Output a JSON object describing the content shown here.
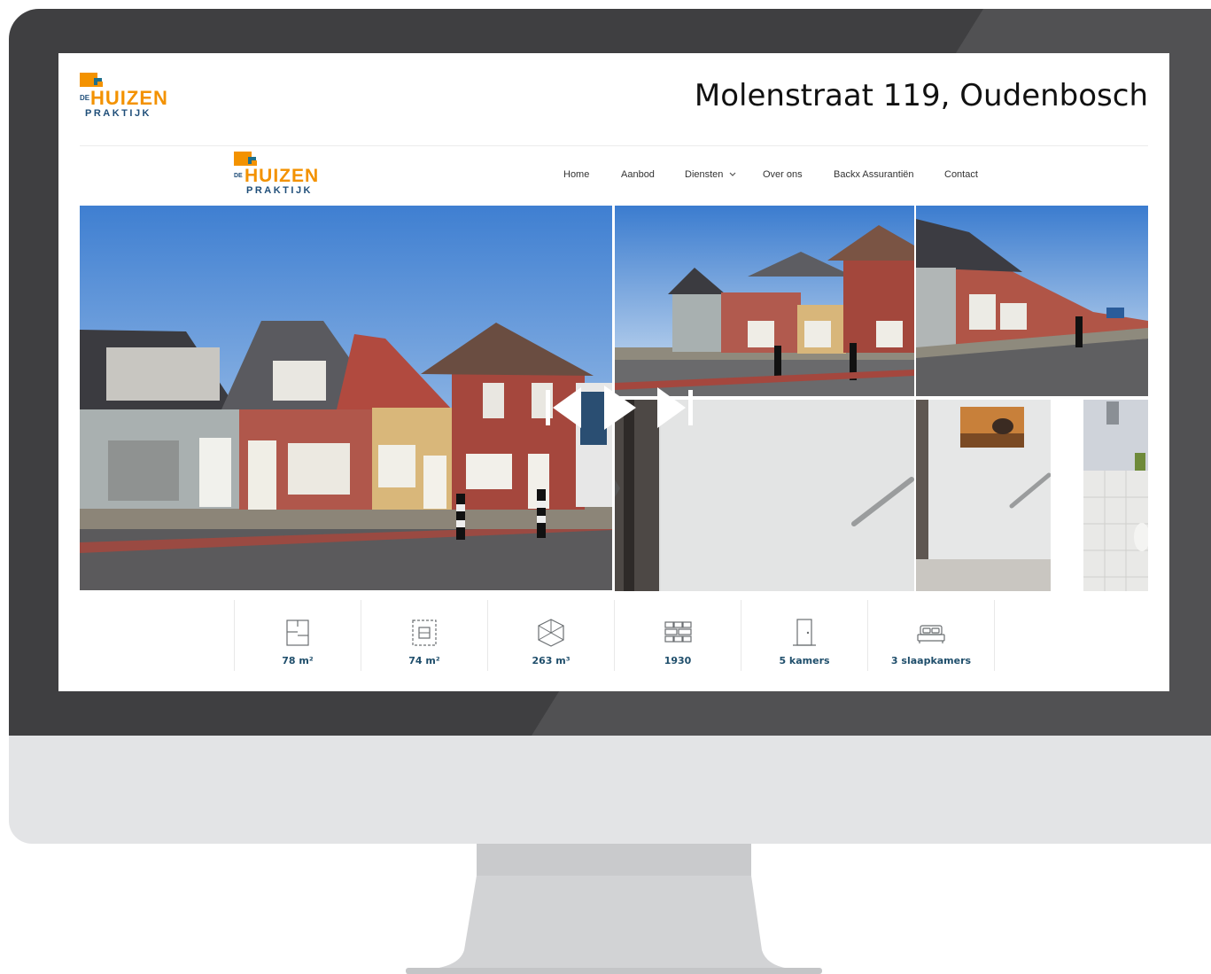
{
  "brand": {
    "logo_prefix": "DE",
    "logo_main": "HUIZEN",
    "logo_sub": "PRAKTIJK",
    "accent_color": "#f39200",
    "navy_color": "#1f4e79"
  },
  "header": {
    "address": "Molenstraat 119, Oudenbosch"
  },
  "nav": {
    "items": [
      {
        "label": "Home"
      },
      {
        "label": "Aanbod"
      },
      {
        "label": "Diensten",
        "icon": "chevron-down-icon"
      },
      {
        "label": "Over ons"
      },
      {
        "label": "Backx Assurantiën"
      },
      {
        "label": "Contact"
      }
    ]
  },
  "slideshow": {
    "controls": [
      "skip-back-icon",
      "previous-icon",
      "play-icon",
      "skip-forward-icon"
    ]
  },
  "stats": [
    {
      "icon": "floor-plan-icon",
      "label": "78 m²"
    },
    {
      "icon": "plot-area-icon",
      "label": "74 m²"
    },
    {
      "icon": "cube-volume-icon",
      "label": "263 m³"
    },
    {
      "icon": "brick-wall-icon",
      "label": "1930"
    },
    {
      "icon": "door-icon",
      "label": "5 kamers"
    },
    {
      "icon": "bed-icon",
      "label": "3 slaapkamers"
    }
  ]
}
